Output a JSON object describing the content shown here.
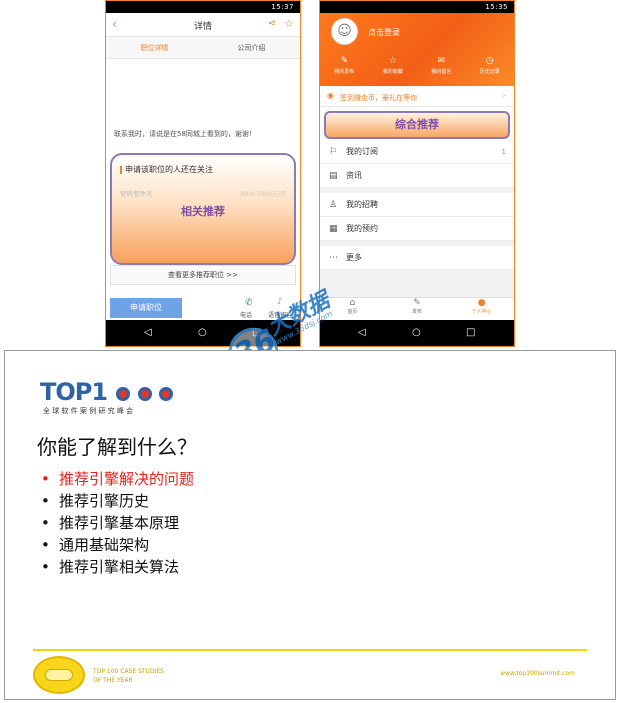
{
  "phone_left": {
    "status_time": "15:37",
    "header_title": "详情",
    "tabs": [
      "职位详情",
      "公司介绍"
    ],
    "contact_text": "联系我时，请说是在58同城上看到的，谢谢!",
    "related_title": "申请该职位的人还在关注",
    "faded_left": "营销/整件讯",
    "faded_right": "3000-5000元/月",
    "overlay_label": "相关推荐",
    "more_link": "查看更多推荐职位 >>",
    "apply_button": "申请职位",
    "call_label": "电话",
    "voice_label": "语音留言"
  },
  "phone_right": {
    "status_time": "15:35",
    "login_label": "点击登录",
    "quick_actions": [
      "我的发布",
      "我的收藏",
      "我的留言",
      "历史记录"
    ],
    "sign_in_banner": "签到赚金币，豪礼在等你",
    "overlay_label": "综合推荐",
    "menu": [
      {
        "label": "我的订阅",
        "badge": "1"
      },
      {
        "label": "资讯",
        "badge": ""
      },
      {
        "label": "我的招聘",
        "badge": ""
      },
      {
        "label": "我的预约",
        "badge": ""
      },
      {
        "label": "更多",
        "badge": ""
      }
    ],
    "bottom_tabs": [
      "首页",
      "发布",
      "个人中心"
    ]
  },
  "watermark": {
    "number": "36",
    "text": "大数据",
    "url": "www.36dsj.com"
  },
  "slide": {
    "logo_text": "TOP1",
    "logo_subtitle": "全 球 软 件 案 例 研 究 峰 会",
    "heading": "你能了解到什么？",
    "bullets": [
      "推荐引擎解决的问题",
      "推荐引擎历史",
      "推荐引擎基本原理",
      "通用基础架构",
      "推荐引擎相关算法"
    ],
    "footer_left_line1": "TOP 100 CASE STUDIES",
    "footer_left_line2": "OF THE YEAR",
    "footer_right": "www.top100summit.com",
    "colors": {
      "accent_red": "#e8201a",
      "footer_line": "#f5d800",
      "footer_text": "#c8a200"
    }
  }
}
